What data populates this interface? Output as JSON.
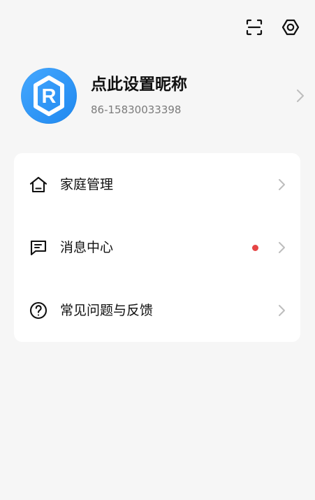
{
  "header": {
    "scan_icon": "scan-icon",
    "settings_icon": "settings-icon"
  },
  "profile": {
    "avatar_letter": "R",
    "nickname": "点此设置昵称",
    "phone": "86-15830033398"
  },
  "menu": {
    "items": [
      {
        "label": "家庭管理",
        "icon": "home-icon"
      },
      {
        "label": "消息中心",
        "icon": "message-icon",
        "badge_color": "#e64545"
      },
      {
        "label": "常见问题与反馈",
        "icon": "help-icon"
      }
    ]
  },
  "colors": {
    "background": "#f6f6f6",
    "card": "#ffffff",
    "accent": "#2a93f6",
    "badge": "#e64545",
    "text": "#111111",
    "muted": "#7b7b7b"
  }
}
